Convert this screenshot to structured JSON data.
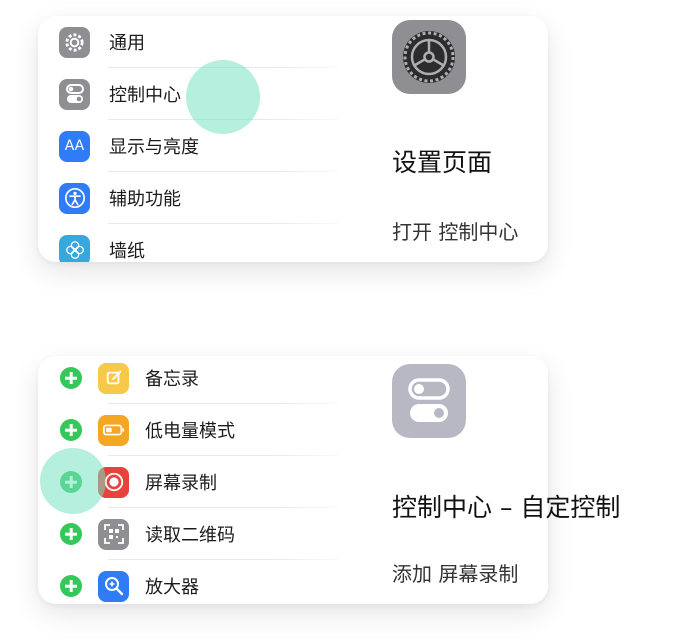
{
  "panel1": {
    "items": [
      {
        "label": "通用",
        "icon": "gear-icon",
        "color": "#8e8e93"
      },
      {
        "label": "控制中心",
        "icon": "switches-icon",
        "color": "#8e8e93"
      },
      {
        "label": "显示与亮度",
        "icon": "text-size-icon",
        "icon_text": "AA",
        "color": "#2f7cf6"
      },
      {
        "label": "辅助功能",
        "icon": "accessibility-icon",
        "color": "#2f7cf6"
      },
      {
        "label": "墙纸",
        "icon": "wallpaper-flower-icon",
        "color": "#36a8e0"
      }
    ],
    "heading": "设置页面",
    "instruction": "打开 控制中心",
    "big_icon": "settings-gear-icon"
  },
  "panel2": {
    "items": [
      {
        "label": "备忘录",
        "icon": "notes-icon",
        "color": "#f7c948"
      },
      {
        "label": "低电量模式",
        "icon": "battery-icon",
        "color": "#f5a623"
      },
      {
        "label": "屏幕录制",
        "icon": "screen-record-icon",
        "color": "#e5433b"
      },
      {
        "label": "读取二维码",
        "icon": "qr-code-icon",
        "color": "#8e8e93"
      },
      {
        "label": "放大器",
        "icon": "magnifier-icon",
        "color": "#2f7cf6"
      }
    ],
    "heading": "控制中心 – 自定控制",
    "instruction": "添加 屏幕录制",
    "big_icon": "control-center-switches-icon"
  },
  "colors": {
    "add_green": "#34c759",
    "tap_highlight": "#78e1c3"
  }
}
